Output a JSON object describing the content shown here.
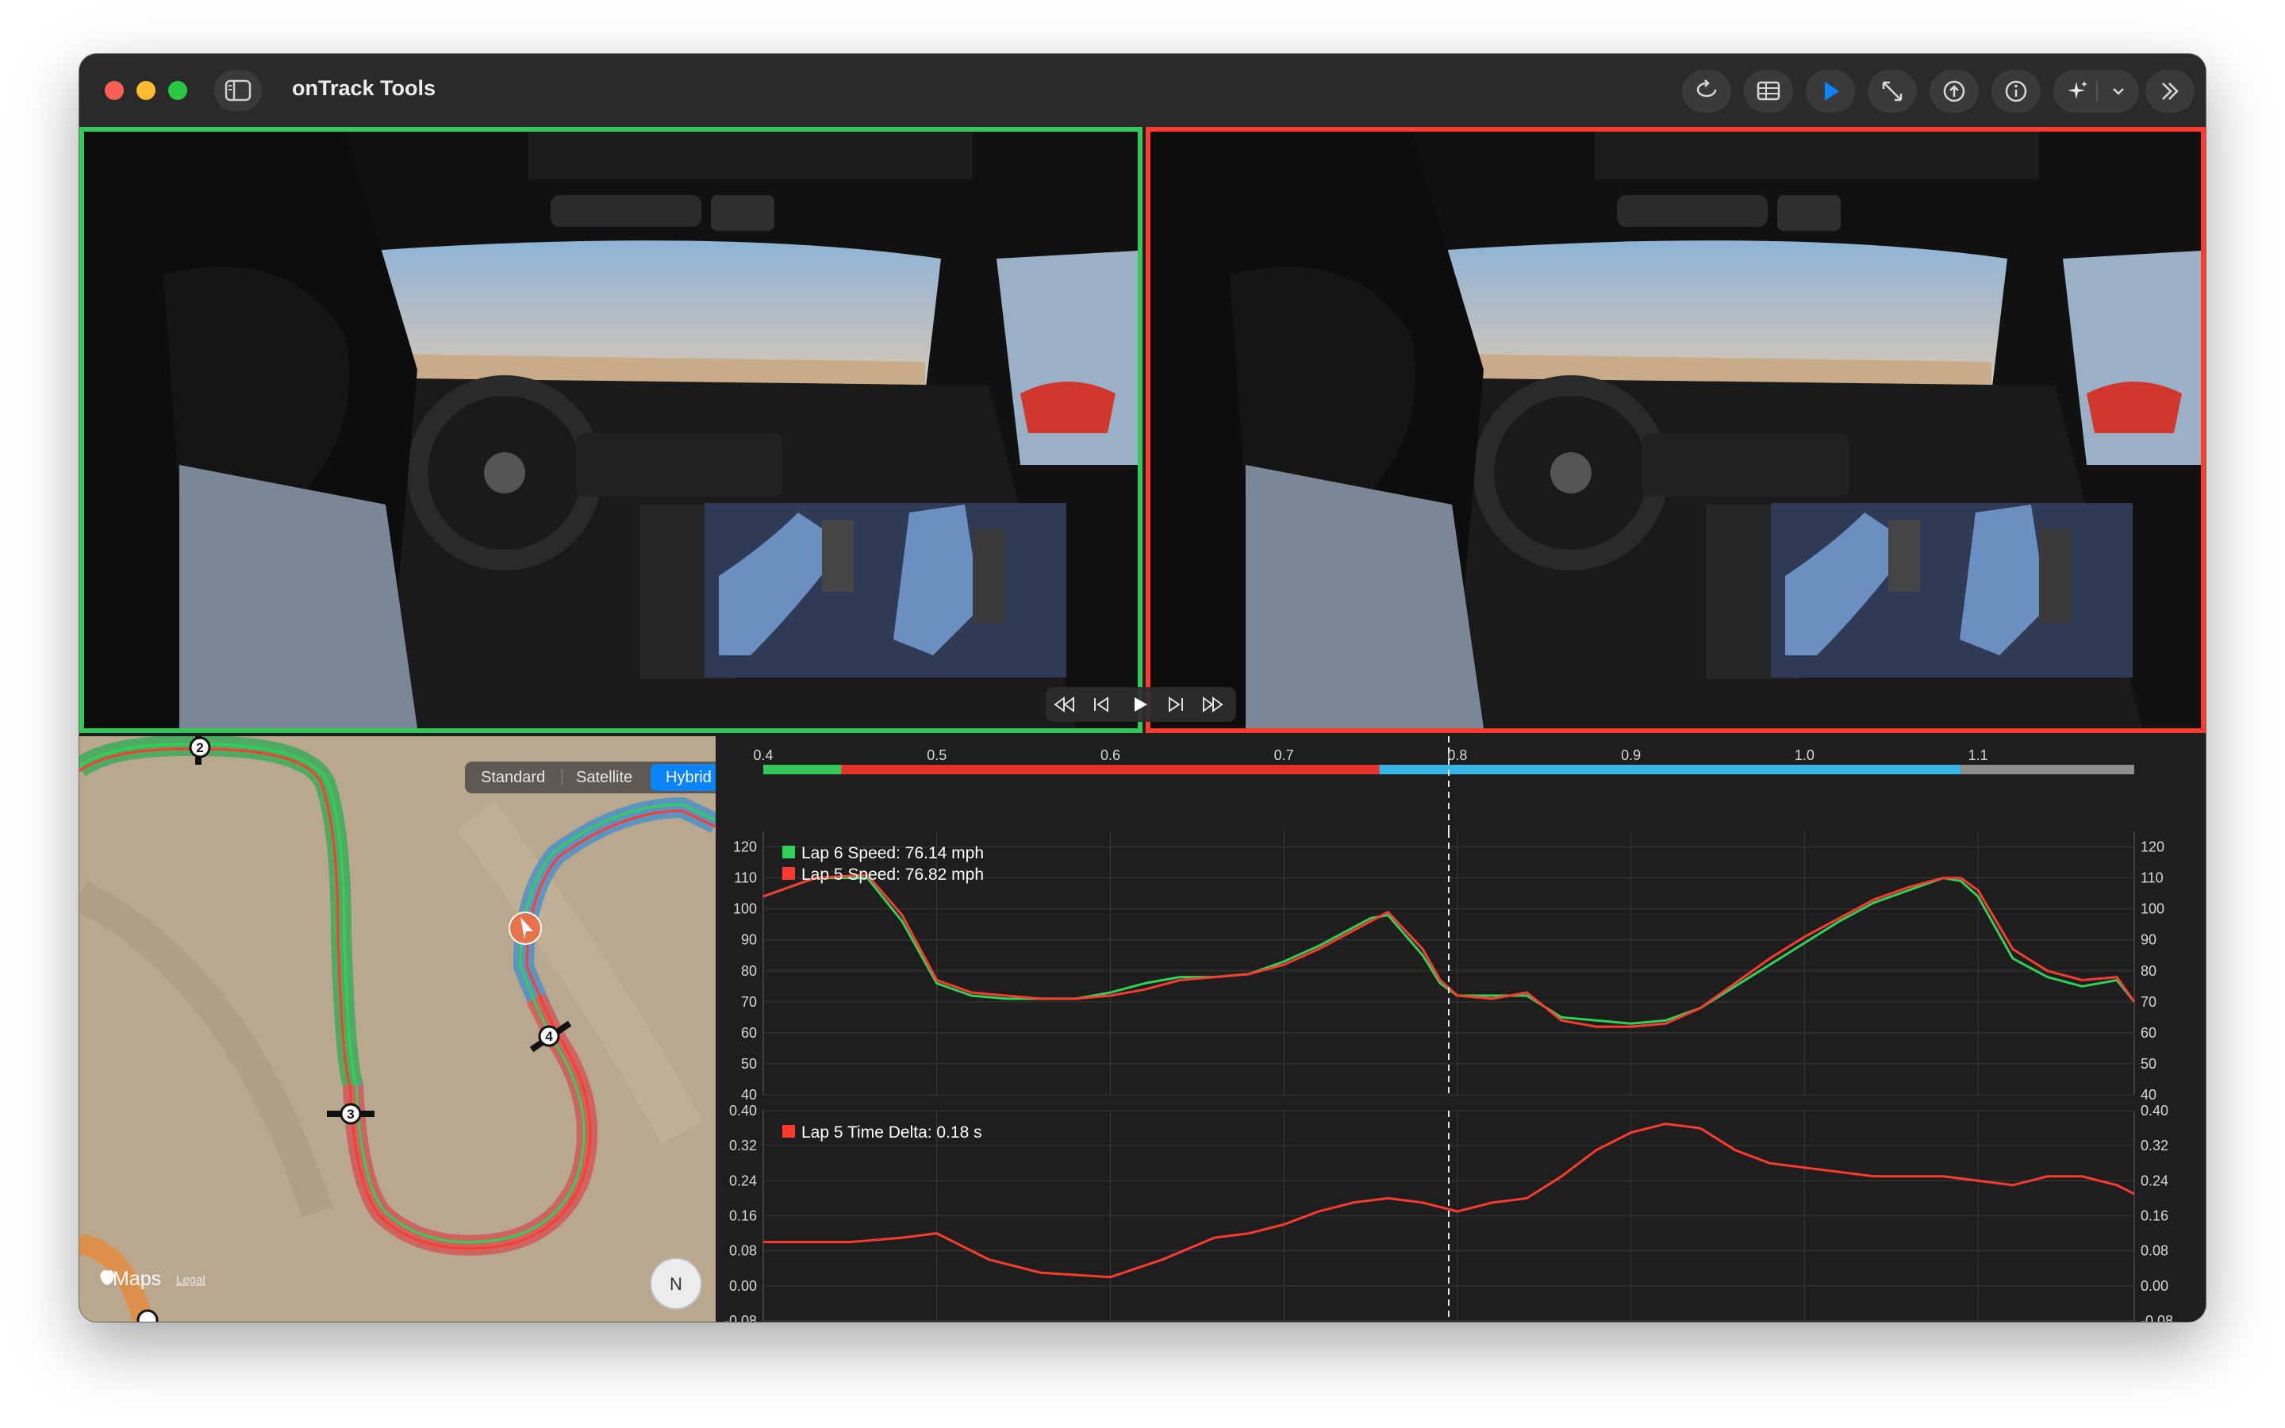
{
  "window": {
    "title": "onTrack Tools"
  },
  "toolbar": {
    "buttons": [
      {
        "id": "loop",
        "icon": "loop-icon"
      },
      {
        "id": "table",
        "icon": "table-icon"
      },
      {
        "id": "play",
        "icon": "play-icon"
      },
      {
        "id": "resize",
        "icon": "resize-icon"
      },
      {
        "id": "sync",
        "icon": "sync-icon"
      },
      {
        "id": "info",
        "icon": "info-icon"
      },
      {
        "id": "magic",
        "icon": "sparkle-icon"
      },
      {
        "id": "more",
        "icon": "chevron-double-right-icon"
      }
    ],
    "playing_accent": "#0a84ff"
  },
  "videos": [
    {
      "id": "left",
      "border_color": "#34c759"
    },
    {
      "id": "right",
      "border_color": "#ff3b30"
    }
  ],
  "transport": {
    "buttons": [
      "skip-back-icon",
      "step-back-icon",
      "play-icon",
      "step-forward-icon",
      "skip-forward-icon"
    ]
  },
  "map": {
    "modes": [
      "Standard",
      "Satellite",
      "Hybrid"
    ],
    "selected_mode": "Hybrid",
    "turn_markers": [
      "2",
      "3",
      "4"
    ],
    "brand": "Maps",
    "legal": "Legal",
    "compass": "N"
  },
  "chart_data": [
    {
      "type": "line",
      "x_ticks": [
        "0.4",
        "0.5",
        "0.6",
        "0.7",
        "0.8",
        "0.9",
        "1.0",
        "1.1"
      ],
      "xlim": [
        0.4,
        1.19
      ],
      "ylim": [
        40,
        125
      ],
      "y_ticks": [
        "40",
        "50",
        "60",
        "70",
        "80",
        "90",
        "100",
        "110",
        "120"
      ],
      "cursor_x": 0.795,
      "sector_bar": [
        {
          "from": 0.4,
          "to": 0.445,
          "color": "#34c759"
        },
        {
          "from": 0.445,
          "to": 0.755,
          "color": "#e8332d"
        },
        {
          "from": 0.755,
          "to": 1.09,
          "color": "#36b5e6"
        },
        {
          "from": 1.09,
          "to": 1.19,
          "color": "#8e8e8e"
        }
      ],
      "legend": [
        "Lap 6 Speed: 76.14 mph",
        "Lap 5 Speed: 76.82 mph"
      ],
      "series": [
        {
          "name": "Lap 6 Speed: 76.14 mph",
          "color": "#30d158",
          "x": [
            0.4,
            0.43,
            0.46,
            0.48,
            0.5,
            0.52,
            0.54,
            0.56,
            0.58,
            0.6,
            0.62,
            0.64,
            0.66,
            0.68,
            0.7,
            0.72,
            0.74,
            0.75,
            0.76,
            0.78,
            0.79,
            0.8,
            0.82,
            0.84,
            0.86,
            0.88,
            0.9,
            0.92,
            0.94,
            0.96,
            0.98,
            1.0,
            1.02,
            1.04,
            1.06,
            1.08,
            1.09,
            1.1,
            1.12,
            1.14,
            1.16,
            1.18,
            1.19
          ],
          "y": [
            104,
            110,
            110,
            96,
            76,
            72,
            71,
            71,
            71,
            73,
            76,
            78,
            78,
            79,
            83,
            88,
            94,
            97,
            98,
            85,
            76,
            72,
            72,
            72,
            65,
            64,
            63,
            64,
            68,
            75,
            82,
            89,
            96,
            102,
            106,
            110,
            109,
            104,
            84,
            78,
            75,
            77,
            70
          ]
        },
        {
          "name": "Lap 5 Speed: 76.82 mph",
          "color": "#ff3b30",
          "x": [
            0.4,
            0.43,
            0.46,
            0.48,
            0.5,
            0.52,
            0.54,
            0.56,
            0.58,
            0.6,
            0.62,
            0.64,
            0.66,
            0.68,
            0.7,
            0.72,
            0.74,
            0.75,
            0.76,
            0.78,
            0.79,
            0.8,
            0.82,
            0.84,
            0.86,
            0.88,
            0.9,
            0.92,
            0.94,
            0.96,
            0.98,
            1.0,
            1.02,
            1.04,
            1.06,
            1.08,
            1.09,
            1.1,
            1.12,
            1.14,
            1.16,
            1.18,
            1.19
          ],
          "y": [
            104,
            110,
            111,
            98,
            77,
            73,
            72,
            71,
            71,
            72,
            74,
            77,
            78,
            79,
            82,
            87,
            93,
            96,
            99,
            87,
            77,
            72,
            71,
            73,
            64,
            62,
            62,
            63,
            68,
            76,
            84,
            91,
            97,
            103,
            107,
            110,
            110,
            106,
            87,
            80,
            77,
            78,
            70
          ]
        }
      ]
    },
    {
      "type": "line",
      "x_ticks": [
        "0.4",
        "0.5",
        "0.6",
        "0.7",
        "0.8",
        "0.9",
        "1.0",
        "1.1"
      ],
      "xlim": [
        0.4,
        1.19
      ],
      "ylim": [
        -0.08,
        0.4
      ],
      "y_ticks": [
        "-0.08",
        "0.00",
        "0.08",
        "0.16",
        "0.24",
        "0.32",
        "0.40"
      ],
      "cursor_x": 0.795,
      "legend": [
        "Lap 5 Time Delta: 0.18 s"
      ],
      "series": [
        {
          "name": "Lap 5 Time Delta: 0.18 s",
          "color": "#ff3b30",
          "x": [
            0.4,
            0.45,
            0.48,
            0.5,
            0.53,
            0.56,
            0.6,
            0.63,
            0.66,
            0.68,
            0.7,
            0.72,
            0.74,
            0.76,
            0.78,
            0.8,
            0.82,
            0.84,
            0.86,
            0.88,
            0.9,
            0.92,
            0.94,
            0.96,
            0.98,
            1.0,
            1.02,
            1.04,
            1.06,
            1.08,
            1.1,
            1.12,
            1.14,
            1.16,
            1.18,
            1.19
          ],
          "y": [
            0.1,
            0.1,
            0.11,
            0.12,
            0.06,
            0.03,
            0.02,
            0.06,
            0.11,
            0.12,
            0.14,
            0.17,
            0.19,
            0.2,
            0.19,
            0.17,
            0.19,
            0.2,
            0.25,
            0.31,
            0.35,
            0.37,
            0.36,
            0.31,
            0.28,
            0.27,
            0.26,
            0.25,
            0.25,
            0.25,
            0.24,
            0.23,
            0.25,
            0.25,
            0.23,
            0.21
          ]
        }
      ]
    }
  ]
}
